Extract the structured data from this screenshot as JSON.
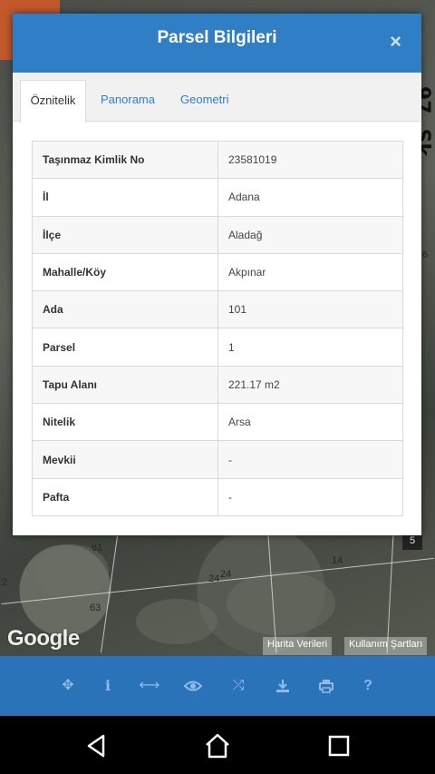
{
  "modal": {
    "title": "Parsel Bilgileri",
    "close_icon": "×"
  },
  "tabs": [
    {
      "label": "Öznitelik",
      "active": true
    },
    {
      "label": "Panorama",
      "active": false
    },
    {
      "label": "Geometri",
      "active": false
    }
  ],
  "attributes": [
    {
      "key": "Taşınmaz Kimlik No",
      "value": "23581019"
    },
    {
      "key": "İl",
      "value": "Adana"
    },
    {
      "key": "İlçe",
      "value": "Aladağ"
    },
    {
      "key": "Mahalle/Köy",
      "value": "Akpınar"
    },
    {
      "key": "Ada",
      "value": "101"
    },
    {
      "key": "Parsel",
      "value": "1"
    },
    {
      "key": "Tapu Alanı",
      "value": "221.17 m2"
    },
    {
      "key": "Nitelik",
      "value": "Arsa"
    },
    {
      "key": "Mevkii",
      "value": "-"
    },
    {
      "key": "Pafta",
      "value": "-"
    }
  ],
  "map": {
    "street": "97. Sk",
    "parcel_labels": [
      "61",
      "2",
      "24",
      "24",
      "63",
      "14",
      "6"
    ],
    "google": "Google",
    "map_data": "Harita Verileri",
    "terms": "Kullanım Şartları",
    "badge": "5"
  },
  "toolbar": {
    "items": [
      {
        "icon": "locate-icon",
        "glyph": "✥"
      },
      {
        "icon": "info-icon",
        "glyph": "i"
      },
      {
        "icon": "measure-icon",
        "glyph": "⟷"
      },
      {
        "icon": "eye-icon",
        "glyph": "👁"
      },
      {
        "icon": "shuffle-icon",
        "glyph": "⤮"
      },
      {
        "icon": "download-icon",
        "glyph": "⤓"
      },
      {
        "icon": "print-icon",
        "glyph": "⎙"
      },
      {
        "icon": "help-icon",
        "glyph": "?"
      }
    ]
  },
  "colors": {
    "header_blue": "#2f7ec6",
    "toolbar_blue": "#2b73b8",
    "map_corner": "#c2582c"
  }
}
